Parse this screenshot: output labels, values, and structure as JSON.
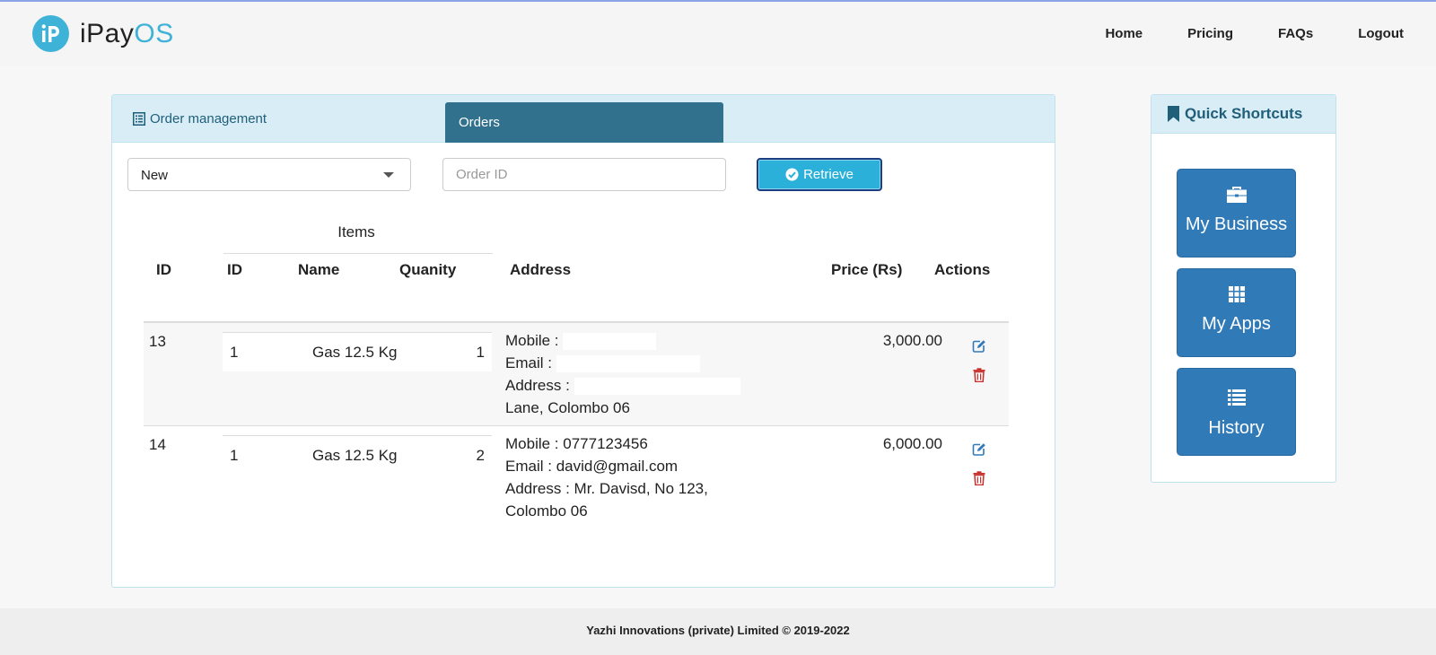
{
  "brand": {
    "name_main": "iPay",
    "name_accent": "OS",
    "logo_letter": "iP"
  },
  "nav": {
    "home": "Home",
    "pricing": "Pricing",
    "faqs": "FAQs",
    "logout": "Logout"
  },
  "panel": {
    "title": "Order management",
    "tab": "Orders",
    "status_select": "New",
    "order_id_placeholder": "Order ID",
    "retrieve_label": "Retrieve"
  },
  "table": {
    "items_group": "Items",
    "headers": {
      "id": "ID",
      "item_id": "ID",
      "name": "Name",
      "quantity": "Quanity",
      "address": "Address",
      "price": "Price (Rs)",
      "actions": "Actions"
    },
    "rows": [
      {
        "id": "13",
        "item_id": "1",
        "item_name": "Gas 12.5 Kg",
        "quantity": "1",
        "mobile_label": "Mobile :",
        "mobile": "",
        "email_label": "Email :",
        "email": "",
        "address_label": "Address :",
        "address": "",
        "address_tail": "Lane, Colombo 06",
        "price": "3,000.00"
      },
      {
        "id": "14",
        "item_id": "1",
        "item_name": "Gas 12.5 Kg",
        "quantity": "2",
        "mobile_label": "Mobile :",
        "mobile": "0777123456",
        "email_label": "Email :",
        "email": "david@gmail.com",
        "address_label": "Address :",
        "address": "Mr. Davisd, No 123,",
        "address_tail": "Colombo 06",
        "price": "6,000.00"
      }
    ]
  },
  "shortcuts": {
    "title": "Quick Shortcuts",
    "items": [
      {
        "label": "My Business",
        "icon": "briefcase-icon"
      },
      {
        "label": "My Apps",
        "icon": "grid-icon"
      },
      {
        "label": "History",
        "icon": "list-icon"
      }
    ]
  },
  "footer": {
    "text": "Yazhi Innovations (private) Limited © 2019-2022"
  },
  "colors": {
    "accent": "#3fb2d8",
    "tab": "#31718e",
    "shortcut": "#317ab8",
    "panel_head": "#d9edf7"
  }
}
